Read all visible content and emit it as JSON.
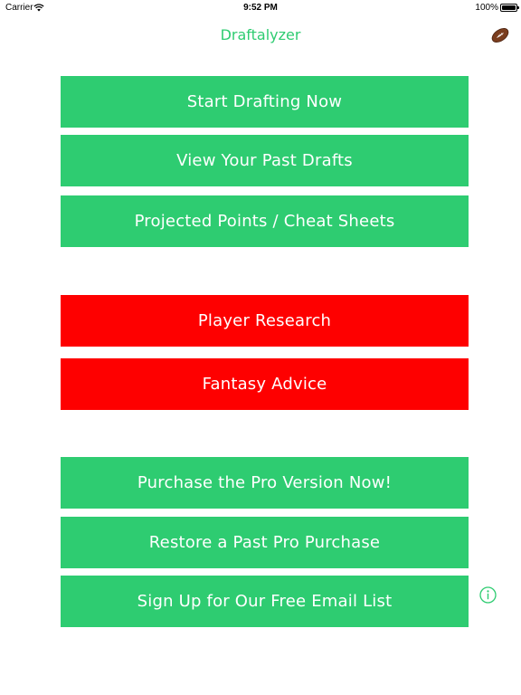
{
  "status_bar": {
    "carrier": "Carrier",
    "time": "9:52 PM",
    "battery": "100%"
  },
  "header": {
    "title": "Draftalyzer",
    "icon": "football-icon"
  },
  "colors": {
    "accent_green": "#2ecc71",
    "alert_red": "#fe0000"
  },
  "menu": {
    "start_drafting": "Start Drafting Now",
    "past_drafts": "View Your Past Drafts",
    "projected_points": "Projected Points / Cheat Sheets",
    "player_research": "Player Research",
    "fantasy_advice": "Fantasy Advice",
    "purchase_pro": "Purchase the Pro Version Now!",
    "restore_pro": "Restore a Past Pro Purchase",
    "email_signup": "Sign Up for Our Free Email List"
  },
  "info_icon": "info-icon"
}
